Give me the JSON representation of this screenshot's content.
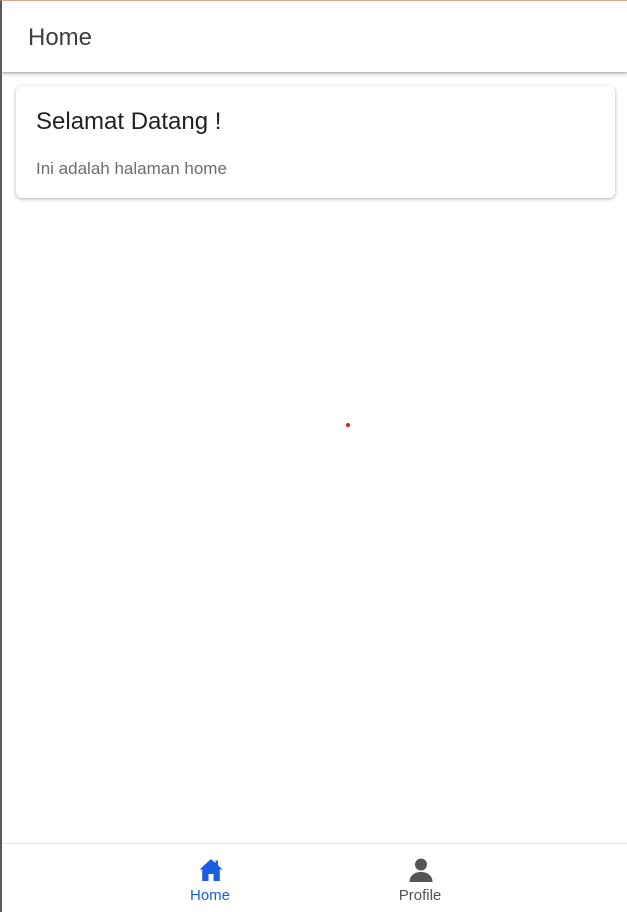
{
  "header": {
    "title": "Home"
  },
  "card": {
    "title": "Selamat Datang !",
    "subtitle": "Ini adalah halaman home"
  },
  "tabs": [
    {
      "label": "Home",
      "icon": "home-icon",
      "selected": true,
      "color": "#1a5fe0"
    },
    {
      "label": "Profile",
      "icon": "person-icon",
      "selected": false,
      "color": "#555555"
    }
  ],
  "colors": {
    "accent": "#1a5fe0",
    "inactive": "#555555",
    "dot": "#e02020"
  }
}
